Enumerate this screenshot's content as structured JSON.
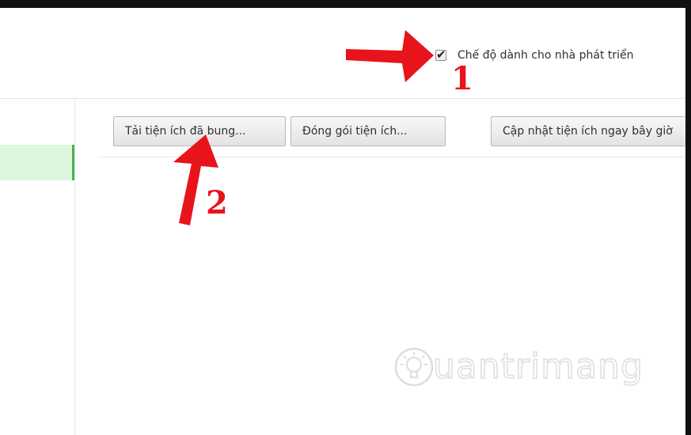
{
  "header": {
    "developer_mode_label": "Chế độ dành cho nhà phát triển",
    "developer_mode_checked": true
  },
  "toolbar": {
    "load_unpacked_label": "Tải tiện ích đã bung...",
    "pack_extension_label": "Đóng gói tiện ích...",
    "update_extensions_label": "Cập nhật tiện ích ngay bây giờ"
  },
  "annotations": {
    "step1": "1",
    "step2": "2",
    "arrow_color": "#e8141b"
  },
  "watermark": {
    "text": "uantrimang"
  },
  "colors": {
    "sidebar_selected_bg": "#dcf7dc",
    "sidebar_selected_border": "#4cb14c"
  }
}
